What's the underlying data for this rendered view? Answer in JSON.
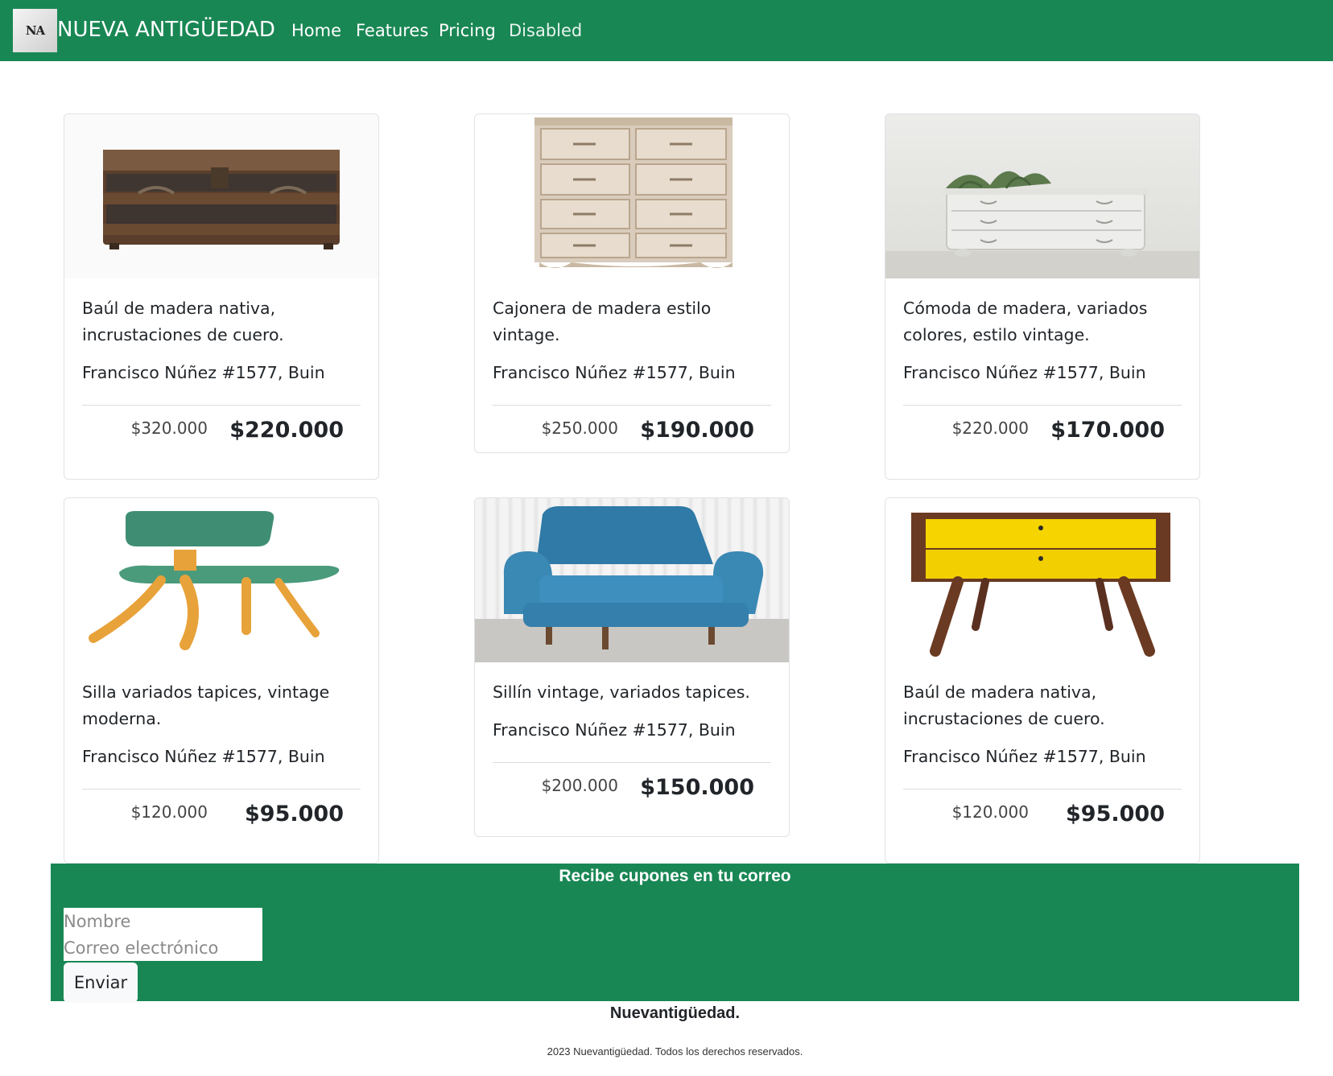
{
  "navbar": {
    "logo_text": "NA",
    "brand": "NUEVA ANTIGÜEDAD",
    "links": [
      {
        "label": "Home"
      },
      {
        "label": "Features"
      },
      {
        "label": "Pricing"
      },
      {
        "label": "Disabled"
      }
    ]
  },
  "products": [
    {
      "title": "Baúl de madera nativa, incrustaciones de cuero.",
      "address": "Francisco Núñez #1577, Buin",
      "old_price": "$320.000",
      "price": "$220.000",
      "image": "wooden-trunk"
    },
    {
      "title": "Cajonera de madera estilo vintage.",
      "address": "Francisco Núñez #1577, Buin",
      "old_price": "$250.000",
      "price": "$190.000",
      "image": "wooden-dresser"
    },
    {
      "title": "Cómoda de madera, variados colores, estilo vintage.",
      "address": "Francisco Núñez #1577, Buin",
      "old_price": "$220.000",
      "price": "$170.000",
      "image": "white-commode"
    },
    {
      "title": "Silla variados tapices, vintage moderna.",
      "address": "Francisco Núñez #1577, Buin",
      "old_price": "$120.000",
      "price": "$95.000",
      "image": "green-chair"
    },
    {
      "title": "Sillín vintage, variados tapices.",
      "address": "Francisco Núñez #1577, Buin",
      "old_price": "$200.000",
      "price": "$150.000",
      "image": "blue-armchair"
    },
    {
      "title": "Baúl de madera nativa, incrustaciones de cuero.",
      "address": "Francisco Núñez #1577, Buin",
      "old_price": "$120.000",
      "price": "$95.000",
      "image": "yellow-sideboard"
    }
  ],
  "subscribe": {
    "title": "Recibe cupones en tu correo",
    "name_placeholder": "Nombre",
    "email_placeholder": "Correo electrónico",
    "button": "Enviar"
  },
  "footer": {
    "brand": "Nuevantigüedad.",
    "copyright": "2023 Nuevantigüedad. Todos los derechos reservados."
  },
  "colors": {
    "brand_green": "#198754",
    "background": "#ffffff"
  }
}
